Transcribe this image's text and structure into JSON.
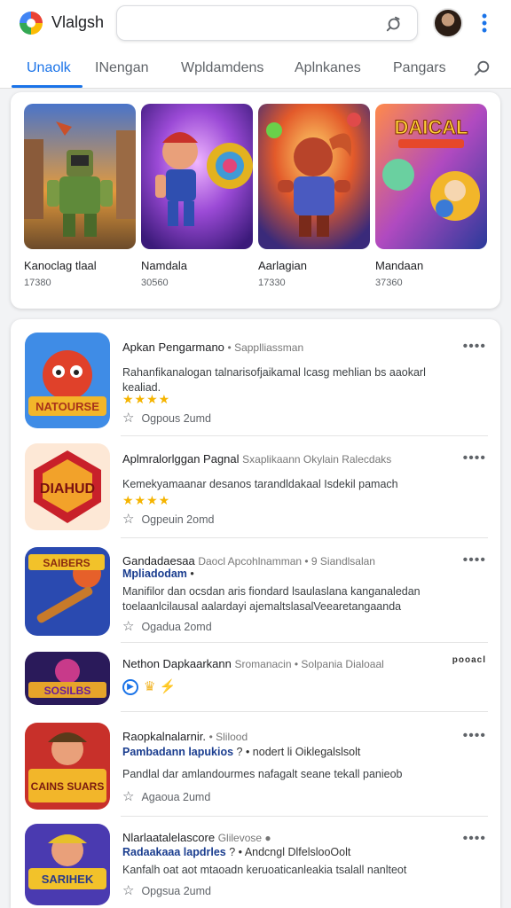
{
  "app": {
    "title": "Vlalgsh"
  },
  "search": {
    "placeholder": ""
  },
  "tabs": [
    {
      "label": "Unaolk",
      "active": true
    },
    {
      "label": "INengan",
      "active": false
    },
    {
      "label": "Wpldamdens",
      "active": false
    },
    {
      "label": "Aplnkanes",
      "active": false
    },
    {
      "label": "Pangars",
      "active": false
    }
  ],
  "featured": [
    {
      "title": "Kanoclag tlaal",
      "count": "17380"
    },
    {
      "title": "Namdala",
      "count": "30560"
    },
    {
      "title": "Aarlagian",
      "count": "17330"
    },
    {
      "title": "Mandaan",
      "count": "37360"
    }
  ],
  "featured_art": {
    "0": {
      "logo": ""
    },
    "3": {
      "logo": "DAICAL"
    }
  },
  "list": [
    {
      "title": "Apkan Pengarmano",
      "title_sub": "• Sapplliassman",
      "desc": "Rahanfikanalogan talnarisofjaikamal lcasg mehlian bs aaokarl kealiad.",
      "stars": "★★★★",
      "meta": "Ogpous  2umd",
      "icon_text": "NATOURSE"
    },
    {
      "title": "Aplmralorlggan Pagnal",
      "title_sub": "Sxaplikaann  Okylain Ralecdaks",
      "desc": "Kemekyamaanar desanos tarandldakaal Isdekil pamach",
      "stars": "★★★★",
      "meta": "Ogpeuin  2omd",
      "icon_text": "DIAHUD"
    },
    {
      "title": "Gandadaesaa",
      "title_sub": "Daocl Apcohlnamman • 9 Siandlsalan",
      "sub2": "Mpliadodam",
      "sub2_extra": "•",
      "desc": "Manifilor dan ocsdan aris fiondard lsaulaslana kanganaledan toelaanlcilausal aalardayi ajemaltslasalVeearetangaanda",
      "meta": "Ogadua  2omd",
      "icon_text": "SAIBERS"
    },
    {
      "title": "Nethon Dapkaarkann",
      "title_sub": "Sromanacin • Solpania Dialoaal",
      "badge_right": "pooacl",
      "icon_text": "SOSILBS"
    },
    {
      "title": "Raopkalnalarnir.",
      "title_sub": "• Slilood",
      "sub2": "Pambadann lapukios",
      "sub2_extra": "? • nodert li Oiklegalslsolt",
      "desc": "Pandlal dar amlandourmes nafagalt seane tekall panieob",
      "meta": "Agaoua  2umd",
      "icon_text": "CAINS SUARS"
    },
    {
      "title": "Nlarlaatalelascore",
      "title_sub": "Glilevose ●",
      "sub2": "Radaakaaa lapdrles",
      "sub2_extra": "? • Andcngl DlfelslooOolt",
      "desc": "Kanfalh oat aot mtaoadn keruoaticanleakia tsalall nanlteot",
      "meta": "Opgsua  2umd",
      "icon_text": "SARIHEK"
    }
  ],
  "colors": {
    "accent": "#1a73e8",
    "star": "#f5b400"
  }
}
